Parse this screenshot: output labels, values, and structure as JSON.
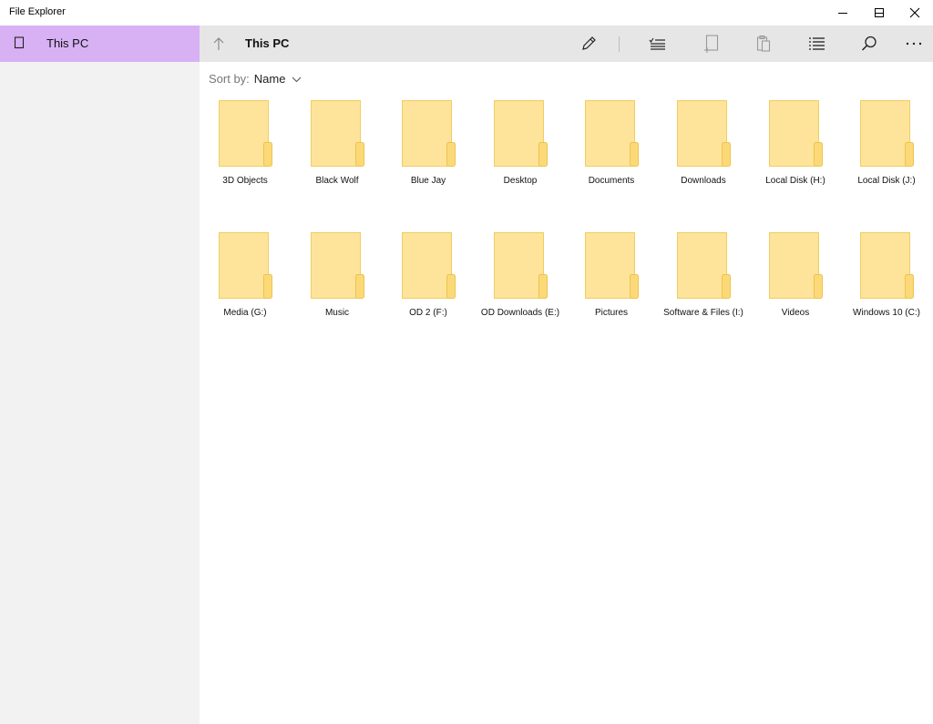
{
  "window": {
    "title": "File Explorer",
    "controls": [
      "minimize",
      "maximize",
      "close"
    ]
  },
  "sidebar": {
    "items": [
      {
        "label": "This PC",
        "icon": "device-icon",
        "selected": true
      }
    ]
  },
  "toolbar": {
    "location": "This PC",
    "buttons": [
      "rename-pencil-icon",
      "select-checklist-icon",
      "new-item-icon",
      "paste-clipboard-icon",
      "list-view-icon",
      "search-icon",
      "more-icon"
    ]
  },
  "content": {
    "sort_label": "Sort by:",
    "sort_value": "Name",
    "items": [
      {
        "name": "3D Objects"
      },
      {
        "name": "Black Wolf"
      },
      {
        "name": "Blue Jay"
      },
      {
        "name": "Desktop"
      },
      {
        "name": "Documents"
      },
      {
        "name": "Downloads"
      },
      {
        "name": "Local Disk (H:)"
      },
      {
        "name": "Local Disk (J:)"
      },
      {
        "name": "Media (G:)"
      },
      {
        "name": "Music"
      },
      {
        "name": "OD 2 (F:)"
      },
      {
        "name": "OD Downloads (E:)"
      },
      {
        "name": "Pictures"
      },
      {
        "name": "Software & Files (I:)"
      },
      {
        "name": "Videos"
      },
      {
        "name": "Windows 10 (C:)"
      }
    ]
  },
  "colors": {
    "sidebar_bg": "#f2f2f2",
    "selected_bg": "#d8b1f5",
    "toolbar_bg": "#e6e6e6",
    "folder_fill": "#fde28c",
    "folder_edge": "#f2cc5a"
  }
}
